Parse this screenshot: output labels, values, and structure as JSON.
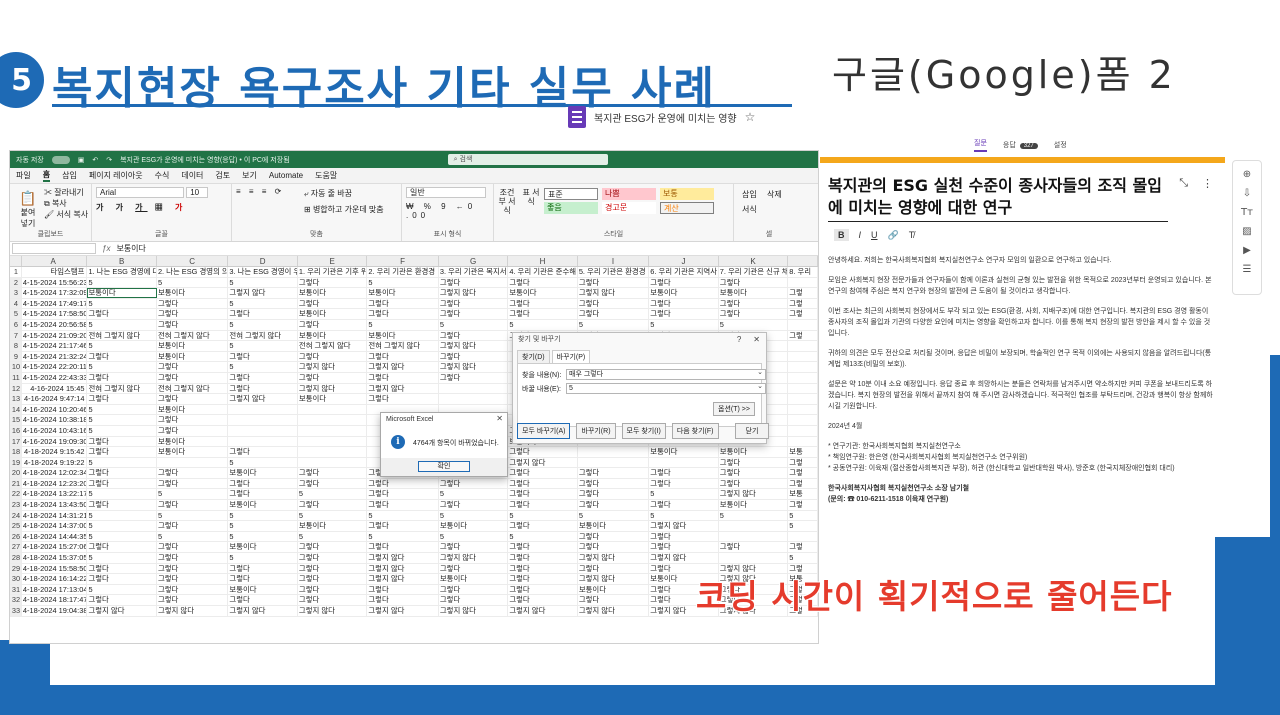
{
  "slide": {
    "number": "5",
    "title": "복지현장 욕구조사 기타 실무 사례",
    "google_form_label": "구글(Google)폼  2",
    "caption": "코딩 시간이 획기적으로 줄어든다"
  },
  "form_doc": {
    "title": "복지관 ESG가 운영에 미치는 영향"
  },
  "excel": {
    "titlebar": {
      "autosave": "자동 저장",
      "file": "복지관 ESG가 운영에 미치는 영향(응답) • 이 PC에 저장됨",
      "search": "검색"
    },
    "menu": [
      "파일",
      "홈",
      "삽입",
      "페이지 레이아웃",
      "수식",
      "데이터",
      "검토",
      "보기",
      "Automate",
      "도움말"
    ],
    "ribbon": {
      "clipboard": {
        "paste": "붙여넣기",
        "cut": "잘라내기",
        "copy": "복사",
        "format": "서식 복사",
        "label": "클립보드"
      },
      "font": {
        "name": "Arial",
        "size": "10",
        "label": "글꼴"
      },
      "align": {
        "wrap": "자동 줄 바꿈",
        "merge": "병합하고 가운데 맞춤",
        "label": "맞춤"
      },
      "number": {
        "format": "일반",
        "label": "표시 형식"
      },
      "styles": {
        "cond": "조건부 서식",
        "table": "표 서식",
        "normal": "표준",
        "bad": "나쁨",
        "good": "보통",
        "medium": "좋음",
        "neutral": "경고문",
        "calc": "계산",
        "label": "스타일"
      },
      "cells": {
        "insert": "삽입",
        "delete": "삭제",
        "format": "서식",
        "label": "셀"
      }
    },
    "formula_value": "보통이다",
    "columns": [
      "A",
      "B",
      "C",
      "D",
      "E",
      "F",
      "G",
      "H",
      "I",
      "J",
      "K"
    ],
    "header_row": [
      "타임스탬프",
      "1. 나는 ESG 경영에 대",
      "2. 나는 ESG 경영의 의",
      "3. 나는 ESG 경영이 우",
      "1. 우리 기관은 기후 위",
      "2. 우리 기관은 환경경",
      "3. 우리 기관은 복지서",
      "4. 우리 기관은 준수해",
      "5. 우리 기관은 환경경",
      "6. 우리 기관은 지역사",
      "7. 우리 기관은 신규 채",
      "8. 우리"
    ],
    "rows": [
      [
        "4-15-2024 15:56:23",
        "5",
        "5",
        "5",
        "그렇다",
        "5",
        "그렇다",
        "그렇다",
        "그렇다",
        "그렇다",
        "그렇다",
        ""
      ],
      [
        "4-15-2024 17:32:09",
        "보통이다",
        "보통이다",
        "그렇지 않다",
        "보통이다",
        "보통이다",
        "그렇지 않다",
        "보통이다",
        "그렇지 않다",
        "보통이다",
        "보통이다",
        "그렇"
      ],
      [
        "4-15-2024 17:49:17",
        "5",
        "그렇다",
        "5",
        "그렇다",
        "그렇다",
        "그렇다",
        "그렇다",
        "그렇다",
        "그렇다",
        "그렇다",
        "그렇"
      ],
      [
        "4-15-2024 17:58:50",
        "그렇다",
        "그렇다",
        "그렇다",
        "보통이다",
        "그렇다",
        "그렇다",
        "그렇다",
        "그렇다",
        "그렇다",
        "그렇다",
        "그렇"
      ],
      [
        "4-15-2024 20:56:58",
        "5",
        "그렇다",
        "5",
        "그렇다",
        "5",
        "5",
        "5",
        "5",
        "5",
        "5",
        ""
      ],
      [
        "4-15-2024 21:09:20",
        "전혀 그렇지 않다",
        "전혀 그렇지 않다",
        "전혀 그렇지 않다",
        "보통이다",
        "보통이다",
        "그렇다",
        "그렇다",
        "그렇다",
        "그렇다",
        "그렇다",
        "그렇"
      ],
      [
        "4-15-2024 21:17:46",
        "5",
        "보통이다",
        "5",
        "전혀 그렇지 않다",
        "전혀 그렇지 않다",
        "그렇지 않다",
        "",
        "",
        "",
        "",
        ""
      ],
      [
        "4-15-2024 21:32:24",
        "그렇다",
        "보통이다",
        "그렇다",
        "그렇다",
        "그렇다",
        "그렇다",
        "",
        "",
        "",
        "",
        ""
      ],
      [
        "4-15-2024 22:20:11",
        "5",
        "그렇다",
        "5",
        "그렇지 않다",
        "그렇지 않다",
        "그렇지 않다",
        "",
        "",
        "",
        "",
        ""
      ],
      [
        "4-15-2024 22:43:33",
        "그렇다",
        "그렇다",
        "그렇다",
        "그렇다",
        "그렇다",
        "그렇다",
        "",
        "",
        "",
        "",
        ""
      ],
      [
        "4-16-2024 15:45",
        "전혀 그렇지 않다",
        "전혀 그렇지 않다",
        "그렇다",
        "그렇지 않다",
        "그렇지 않다",
        "",
        "",
        "",
        "",
        "",
        ""
      ],
      [
        "4-16-2024 9:47:14",
        "그렇다",
        "그렇다",
        "그렇지 않다",
        "보통이다",
        "그렇다",
        "",
        "",
        "",
        "",
        "",
        ""
      ],
      [
        "4-16-2024 10:20:46",
        "5",
        "보통이다",
        "",
        "",
        "",
        "",
        "",
        "",
        "",
        "",
        ""
      ],
      [
        "4-16-2024 10:38:18",
        "5",
        "그렇다",
        "",
        "",
        "",
        "",
        "",
        "",
        "",
        "",
        ""
      ],
      [
        "4-16-2024 10:43:16",
        "5",
        "그렇다",
        "",
        "",
        "",
        "",
        "그렇다",
        "",
        "그렇다",
        "",
        ""
      ],
      [
        "4-16-2024 19:09:30",
        "그렇다",
        "보통이다",
        "",
        "",
        "",
        "",
        "보통이다",
        "",
        "",
        "",
        ""
      ],
      [
        "4-18-2024 9:15:42",
        "그렇다",
        "보통이다",
        "그렇다",
        "",
        "",
        "",
        "그렇다",
        "",
        "보통이다",
        "보통이다",
        "보통"
      ],
      [
        "4-18-2024 9:19:22",
        "5",
        "",
        "5",
        "",
        "",
        "",
        "그렇지 않다",
        "",
        "",
        "그렇다",
        "그렇"
      ],
      [
        "4-18-2024 12:02:34",
        "그렇다",
        "그렇다",
        "보통이다",
        "그렇다",
        "그렇다",
        "그렇다",
        "그렇다",
        "그렇다",
        "그렇다",
        "그렇다",
        "그렇"
      ],
      [
        "4-18-2024 12:23:20",
        "그렇다",
        "그렇다",
        "그렇다",
        "그렇다",
        "그렇다",
        "그렇다",
        "그렇다",
        "그렇다",
        "그렇다",
        "그렇다",
        "그렇"
      ],
      [
        "4-18-2024 13:22:17",
        "5",
        "5",
        "그렇다",
        "5",
        "그렇다",
        "5",
        "그렇다",
        "그렇다",
        "5",
        "그렇지 않다",
        "보통"
      ],
      [
        "4-18-2024 13:43:50",
        "그렇다",
        "그렇다",
        "보통이다",
        "그렇다",
        "그렇다",
        "그렇다",
        "그렇다",
        "그렇다",
        "그렇다",
        "보통이다",
        "그렇"
      ],
      [
        "4-18-2024 14:31:21",
        "5",
        "5",
        "5",
        "5",
        "5",
        "5",
        "5",
        "5",
        "5",
        "5",
        "5"
      ],
      [
        "4-18-2024 14:37:00",
        "5",
        "그렇다",
        "5",
        "보통이다",
        "그렇다",
        "보통이다",
        "그렇다",
        "보통이다",
        "그렇지 않다",
        "",
        "5"
      ],
      [
        "4-18-2024 14:44:35",
        "5",
        "5",
        "5",
        "5",
        "5",
        "5",
        "5",
        "그렇다",
        "그렇다",
        "",
        ""
      ],
      [
        "4-18-2024 15:27:06",
        "그렇다",
        "그렇다",
        "보통이다",
        "그렇다",
        "그렇다",
        "그렇다",
        "그렇다",
        "그렇다",
        "그렇다",
        "그렇다",
        "그렇"
      ],
      [
        "4-18-2024 15:37:05",
        "5",
        "그렇다",
        "5",
        "그렇다",
        "그렇지 않다",
        "그렇지 않다",
        "그렇다",
        "그렇지 않다",
        "그렇지 않다",
        "",
        "5"
      ],
      [
        "4-18-2024 15:58:50",
        "그렇다",
        "그렇다",
        "그렇다",
        "그렇다",
        "그렇지 않다",
        "그렇다",
        "그렇다",
        "그렇다",
        "그렇다",
        "그렇지 않다",
        "그렇"
      ],
      [
        "4-18-2024 16:14:22",
        "그렇다",
        "그렇다",
        "그렇다",
        "그렇다",
        "그렇지 않다",
        "보통이다",
        "그렇다",
        "그렇지 않다",
        "보통이다",
        "그렇지 않다",
        "보통"
      ],
      [
        "4-18-2024 17:13:04",
        "5",
        "그렇다",
        "보통이다",
        "그렇다",
        "그렇다",
        "그렇다",
        "그렇다",
        "보통이다",
        "그렇다",
        "그렇다",
        "그렇"
      ],
      [
        "4-18-2024 18:17:47",
        "그렇다",
        "그렇다",
        "그렇다",
        "그렇다",
        "그렇다",
        "그렇다",
        "그렇다",
        "그렇다",
        "그렇다",
        "그렇다",
        "그렇"
      ],
      [
        "4-18-2024 19:04:38",
        "그렇지 않다",
        "그렇지 않다",
        "그렇지 않다",
        "그렇지 않다",
        "그렇지 않다",
        "그렇지 않다",
        "그렇지 않다",
        "그렇지 않다",
        "그렇지 않다",
        "그렇지 않다",
        "그렇"
      ]
    ]
  },
  "find_dialog": {
    "title": "찾기 및 바꾸기",
    "tab_find": "찾기(D)",
    "tab_replace": "바꾸기(P)",
    "find_label": "찾을 내용(N):",
    "find_value": "매우 그렇다",
    "replace_label": "바꿀 내용(E):",
    "replace_value": "5",
    "options": "옵션(T) >>",
    "btn_replace_all": "모두 바꾸기(A)",
    "btn_replace": "바꾸기(R)",
    "btn_find_all": "모두 찾기(I)",
    "btn_find_next": "다음 찾기(F)",
    "btn_close": "닫기"
  },
  "msg_dialog": {
    "title": "Microsoft Excel",
    "message": "4764개 항목이 바뀌었습니다.",
    "ok": "확인"
  },
  "gform": {
    "tabs": [
      "질문",
      "응답",
      "설정"
    ],
    "response_count": "327",
    "title": "복지관의 ESG 실천 수준이 종사자들의 조직 몰입에 미치는 영향에 대한 연구",
    "paragraphs": [
      "안녕하세요. 저희는 한국사회복지협회 복지실천연구소 연구자 모임의 일환으로 연구하고 있습니다.",
      "모임은 사회복지 현장 전문가들과 연구자들이 함께 이론과 실천의 균형 있는 발전을 위한 목적으로 2023년부터 운영되고 있습니다. 본 연구의 참여해 주심은 복지 연구와 현장의 발전에 큰 도움이 될 것이라고 생각합니다.",
      "이번 조사는 최근의 사회복지 현장에서도 부각 되고 있는 ESG(환경, 사회, 지배구조)에 대한 연구입니다. 복지관의 ESG 경영 활동이 종사자의 조직 몰입과 기관의 다양한 요인에 미치는 영향을 확인하고자 합니다. 이를 통해 복지 현장의 발전 방안을 제시 할 수 있을 것입니다.",
      "귀하의 의견은 모두 전산으로 처리될 것이며, 응답은 비밀이 보장되며, 학술적인 연구 목적 이외에는 사용되지 않음을 알려드립니다(통계법 제13조(비밀의 보호)).",
      "설문은 약 10분 이내 소요 예정입니다. 응답 종료 후 희망하시는 분들은 연락처를 남겨주시면 약소하지만 커피 쿠폰을 보내드리도록 하겠습니다. 복지 현장의 발전을 위해서 끝까지 참여 해 주시면 감사하겠습니다. 적극적인 협조를 부탁드리며, 건강과 행복이 항상 함께하시길 기원합니다.",
      "2024년 4월",
      "* 연구기관: 한국사회복지협회 복지실천연구소\n* 책임연구원: 한은영 (한국사회복지사협회 복지실천연구소 연구위원)\n* 공동연구원: 이육재 (절산종합사회복지관 부장), 허관 (한신대학교 일반대학원 박사), 방준호 (한국지체장애인협회 대리)",
      "한국사회복지사협회 복지실천연구소 소장 남기철\n(문의: ☎ 010-6211-1518 이육재 연구원)"
    ]
  }
}
